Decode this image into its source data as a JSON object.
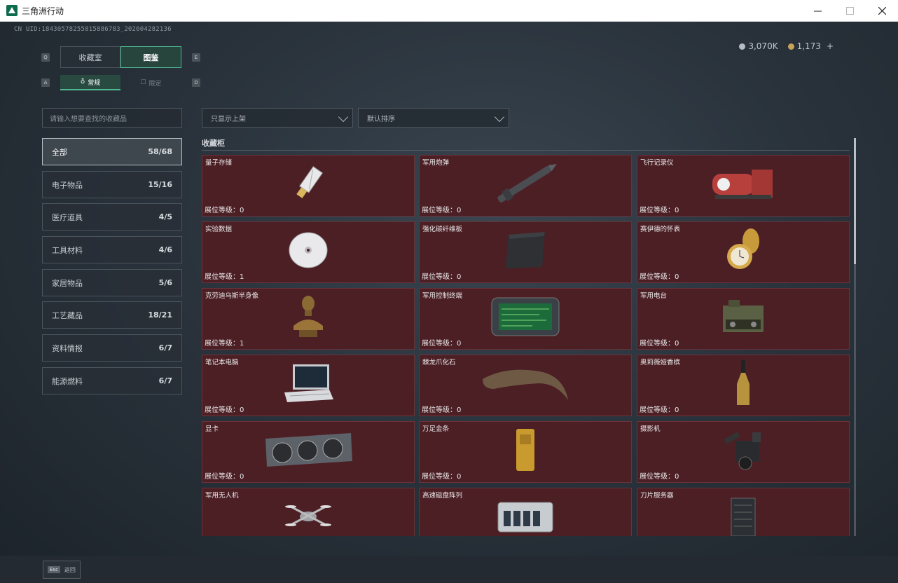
{
  "window": {
    "title": "三角洲行动"
  },
  "user": {
    "uid": "CN UID:18430578255815886783_202604282136"
  },
  "currency": {
    "silver": "3,070K",
    "gold": "1,173",
    "add": "+"
  },
  "tabs": {
    "keys": [
      "Q",
      "E"
    ],
    "items": [
      {
        "label": "收藏室"
      },
      {
        "label": "图鉴"
      }
    ]
  },
  "subtabs": {
    "keys": [
      "A",
      "D"
    ],
    "items": [
      {
        "label": "常规"
      },
      {
        "label": "限定"
      }
    ]
  },
  "search": {
    "placeholder": "请输入想要查找的收藏品"
  },
  "filters": [
    {
      "label": "只显示上架"
    },
    {
      "label": "默认排序"
    }
  ],
  "categories": [
    {
      "label": "全部",
      "count": "58/68"
    },
    {
      "label": "电子物品",
      "count": "15/16"
    },
    {
      "label": "医疗道具",
      "count": "4/5"
    },
    {
      "label": "工具材料",
      "count": "4/6"
    },
    {
      "label": "家居物品",
      "count": "5/6"
    },
    {
      "label": "工艺藏品",
      "count": "18/21"
    },
    {
      "label": "资料情报",
      "count": "6/7"
    },
    {
      "label": "能源燃料",
      "count": "6/7"
    }
  ],
  "section": {
    "title": "收藏柜"
  },
  "items": [
    {
      "name": "量子存储",
      "level": "展位等级：0",
      "icon": "usb-drive-icon"
    },
    {
      "name": "军用炮弹",
      "level": "展位等级：0",
      "icon": "artillery-shell-icon"
    },
    {
      "name": "飞行记录仪",
      "level": "展位等级：0",
      "icon": "flight-recorder-icon"
    },
    {
      "name": "实验数据",
      "level": "展位等级：1",
      "icon": "cd-disc-icon"
    },
    {
      "name": "强化碳纤维板",
      "level": "展位等级：0",
      "icon": "carbon-plate-icon"
    },
    {
      "name": "赛伊德的怀表",
      "level": "展位等级：0",
      "icon": "pocket-watch-icon"
    },
    {
      "name": "克劳迪乌斯半身像",
      "level": "展位等级：1",
      "icon": "bust-statue-icon"
    },
    {
      "name": "军用控制终端",
      "level": "展位等级：0",
      "icon": "control-terminal-icon"
    },
    {
      "name": "军用电台",
      "level": "展位等级：0",
      "icon": "military-radio-icon"
    },
    {
      "name": "笔记本电脑",
      "level": "展位等级：0",
      "icon": "laptop-icon"
    },
    {
      "name": "棘龙爪化石",
      "level": "展位等级：0",
      "icon": "claw-fossil-icon"
    },
    {
      "name": "奥莉薇娅香槟",
      "level": "展位等级：0",
      "icon": "champagne-bottle-icon"
    },
    {
      "name": "显卡",
      "level": "展位等级：0",
      "icon": "graphics-card-icon"
    },
    {
      "name": "万足金条",
      "level": "展位等级：0",
      "icon": "gold-bar-icon"
    },
    {
      "name": "摄影机",
      "level": "展位等级：0",
      "icon": "camera-icon"
    },
    {
      "name": "军用无人机",
      "level": "",
      "icon": "drone-icon"
    },
    {
      "name": "高速磁盘阵列",
      "level": "",
      "icon": "disk-array-icon"
    },
    {
      "name": "刀片服务器",
      "level": "",
      "icon": "blade-server-icon"
    }
  ],
  "footer": {
    "esc_key": "Esc",
    "esc_label": "返回"
  },
  "colors": {
    "accent": "#4fb893",
    "card_bg": "#4c1f25"
  }
}
